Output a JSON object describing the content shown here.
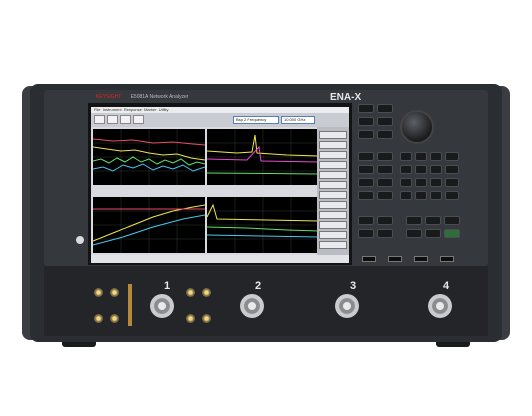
{
  "instrument": {
    "brand": "KEYSIGHT",
    "model": "ENA-X",
    "subtitle": "E5081A Network Analyzer"
  },
  "screen": {
    "menu": [
      "File",
      "Instrument",
      "Response",
      "Marker",
      "Utility"
    ],
    "toolbar_field_label": "Bsp 2 Frequency",
    "toolbar_value": "10.000 GHz"
  },
  "ports": [
    "1",
    "2",
    "3",
    "4"
  ]
}
